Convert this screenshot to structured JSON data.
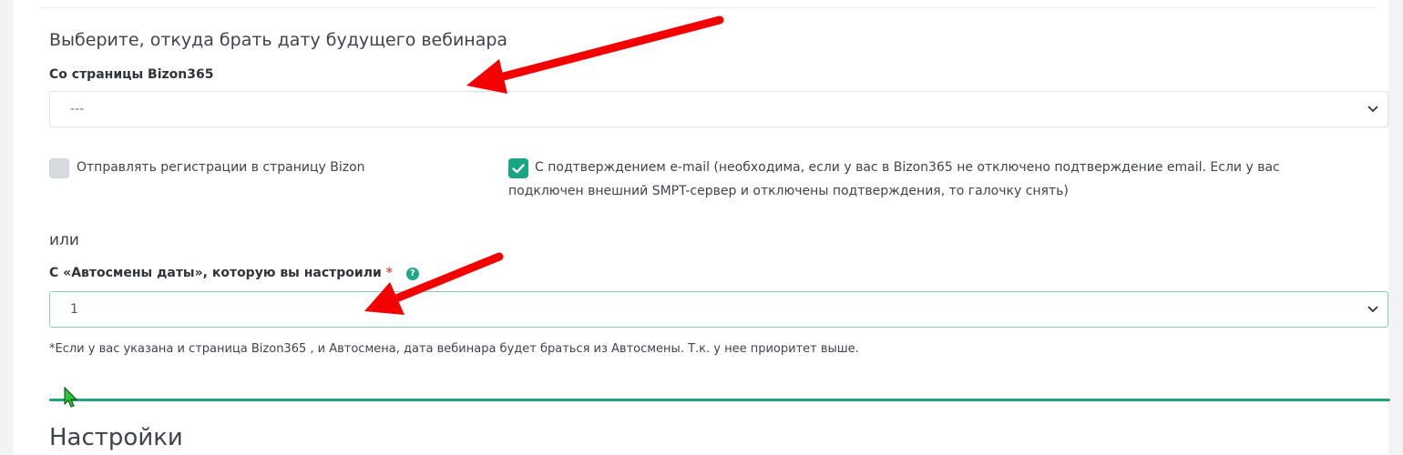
{
  "section": {
    "title": "Выберите, откуда брать дату будущего вебинара"
  },
  "bizon_page": {
    "label": "Со страницы Bizon365",
    "value": "---"
  },
  "checkboxes": {
    "send_registrations": {
      "label": "Отправлять регистрации в страницу Bizon",
      "checked": false
    },
    "email_confirm": {
      "label_line1": "С подтверждением e-mail (необходима, если у вас в Bizon365 не отключено подтверждение email. Если у вас",
      "label_line2": "подключен внешний SMPT-сервер и отключены подтверждения, то галочку снять)",
      "checked": true
    }
  },
  "or_text": "или",
  "autoshift": {
    "label": "С «Автосмены даты», которую вы настроили",
    "required_mark": "*",
    "help_symbol": "?",
    "value": "1"
  },
  "footnote": "*Если у вас указана и страница Bizon365 , и Автосмена, дата вебинара будет браться из Автосмены. Т.к. у нее приоритет выше.",
  "settings": {
    "title": "Настройки"
  },
  "colors": {
    "accent_green": "#16a683",
    "annotation_red": "#ff0000",
    "required_red": "#d9534f"
  },
  "icons": {
    "select_caret": "chevron-down-icon",
    "checkmark": "check-icon",
    "help": "question-circle-icon",
    "cursor": "mouse-pointer-icon"
  }
}
